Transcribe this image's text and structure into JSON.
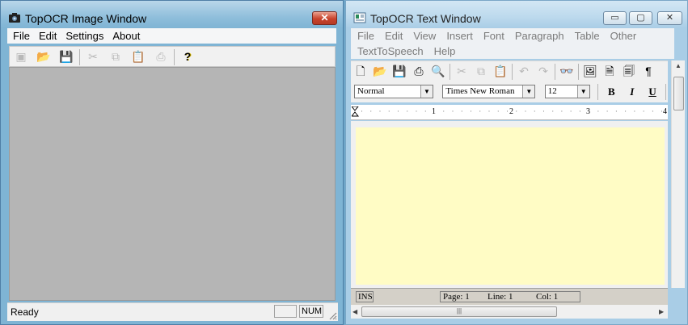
{
  "image_window": {
    "title": "TopOCR  Image Window",
    "title_icon": "camera-icon",
    "menu": [
      "File",
      "Edit",
      "Settings",
      "About"
    ],
    "toolbar": [
      {
        "icon": "scan-icon",
        "glyph": "▣",
        "enabled": false
      },
      {
        "icon": "open-folder-icon",
        "glyph": "📂",
        "enabled": true
      },
      {
        "icon": "save-icon",
        "glyph": "💾",
        "enabled": false
      },
      {
        "icon": "cut-icon",
        "glyph": "✂",
        "enabled": false
      },
      {
        "icon": "copy-icon",
        "glyph": "⧉",
        "enabled": false
      },
      {
        "icon": "paste-icon",
        "glyph": "📋",
        "enabled": false
      },
      {
        "icon": "print-icon",
        "glyph": "⎙",
        "enabled": false
      },
      {
        "icon": "help-icon",
        "glyph": "?",
        "enabled": true
      }
    ],
    "status": {
      "text": "Ready",
      "indicator_1": "",
      "indicator_2": "NUM"
    },
    "close_label": "✕"
  },
  "text_window": {
    "title": "TopOCR Text Window",
    "title_icon": "document-window-icon",
    "caption_buttons": {
      "minimize": "▭",
      "maximize": "▢",
      "close": "✕"
    },
    "menu": [
      "File",
      "Edit",
      "View",
      "Insert",
      "Font",
      "Paragraph",
      "Table",
      "Other",
      "TextToSpeech",
      "Help"
    ],
    "toolbar": [
      {
        "icon": "new-document-icon",
        "glyph": "🗋"
      },
      {
        "icon": "open-folder-icon",
        "glyph": "📂"
      },
      {
        "icon": "save-icon",
        "glyph": "💾"
      },
      {
        "icon": "print-icon",
        "glyph": "⎙"
      },
      {
        "icon": "print-preview-icon",
        "glyph": "🔍"
      },
      {
        "icon": "cut-icon",
        "glyph": "✂"
      },
      {
        "icon": "copy-icon",
        "glyph": "⧉"
      },
      {
        "icon": "paste-icon",
        "glyph": "📋"
      },
      {
        "icon": "undo-icon",
        "glyph": "↶"
      },
      {
        "icon": "redo-icon",
        "glyph": "↷"
      },
      {
        "icon": "find-icon",
        "glyph": "👓"
      },
      {
        "icon": "insert-image-icon",
        "glyph": "🖼"
      },
      {
        "icon": "page-icon",
        "glyph": "🗎"
      },
      {
        "icon": "page-break-icon",
        "glyph": "🗐"
      },
      {
        "icon": "paragraph-mark-icon",
        "glyph": "¶"
      }
    ],
    "style_select": "Normal",
    "font_select": "Times New Roman",
    "size_select": "12",
    "format": {
      "bold": "B",
      "italic": "I",
      "underline": "U"
    },
    "ruler_numbers": [
      "1",
      "2",
      "3",
      "4"
    ],
    "status": {
      "mode": "INS",
      "page": "Page: 1",
      "line": "Line: 1",
      "col": "Col: 1"
    },
    "editor_background": "#fffcc5"
  }
}
